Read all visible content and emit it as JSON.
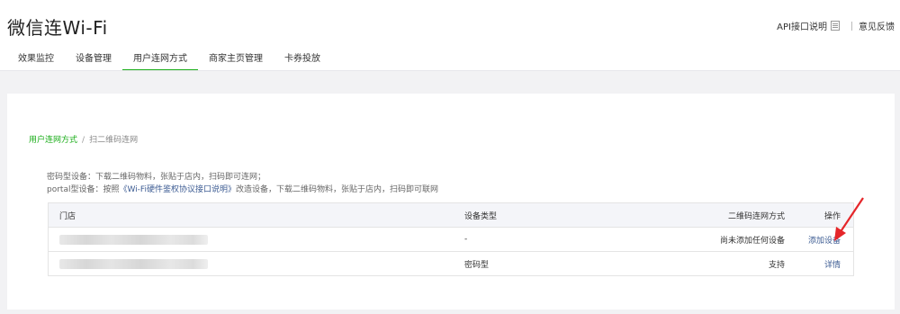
{
  "header": {
    "title": "微信连Wi-Fi",
    "api_link": "API接口说明",
    "feedback_link": "意见反馈"
  },
  "tabs": [
    {
      "label": "效果监控",
      "active": false
    },
    {
      "label": "设备管理",
      "active": false
    },
    {
      "label": "用户连网方式",
      "active": true
    },
    {
      "label": "商家主页管理",
      "active": false
    },
    {
      "label": "卡券投放",
      "active": false
    }
  ],
  "breadcrumb": {
    "parent": "用户连网方式",
    "separator": "/",
    "current": "扫二维码连网"
  },
  "description": {
    "line1": "密码型设备：下载二维码物料，张贴于店内，扫码即可连网；",
    "line2_prefix": "portal型设备：按照",
    "line2_link": "《Wi-Fi硬件鉴权协议接口说明》",
    "line2_suffix": "改造设备，下载二维码物料，张贴于店内，扫码即可联网"
  },
  "table": {
    "headers": [
      "门店",
      "设备类型",
      "二维码连网方式",
      "操作"
    ],
    "rows": [
      {
        "store": "",
        "device_type": "-",
        "qr_method": "尚未添加任何设备",
        "action": "添加设备"
      },
      {
        "store": "",
        "device_type": "密码型",
        "qr_method": "支持",
        "action": "详情"
      }
    ]
  },
  "colors": {
    "accent_green": "#1aad19",
    "link_blue": "#3d5c93",
    "annotation_red": "#e5262a"
  }
}
